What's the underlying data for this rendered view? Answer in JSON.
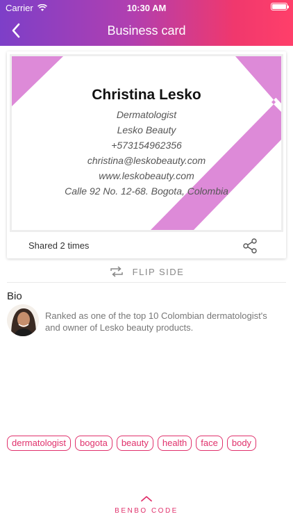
{
  "status_bar": {
    "carrier": "Carrier",
    "time": "10:30 AM",
    "battery_level": 1.0
  },
  "nav": {
    "title": "Business card",
    "back_icon": "chevron-left-icon"
  },
  "card": {
    "name": "Christina Lesko",
    "lines": [
      "Dermatologist",
      "Lesko Beauty",
      "+573154962356",
      "christina@leskobeauty.com",
      "www.leskobeauty.com",
      "Calle 92 No. 12-68. Bogota, Colombia"
    ],
    "accent_color": "#dd8ad8"
  },
  "shared": {
    "text": "Shared 2 times",
    "share_icon": "share-icon"
  },
  "flip": {
    "label": "FLIP SIDE",
    "icon": "flip-arrows-icon"
  },
  "bio": {
    "title": "Bio",
    "text": "Ranked as one of the top 10 Colombian dermatologist's and owner of Lesko beauty products."
  },
  "tags": [
    "dermatologist",
    "bogota",
    "beauty",
    "health",
    "face",
    "body"
  ],
  "footer": {
    "label": "BENBO CODE",
    "icon": "chevron-up-icon"
  },
  "colors": {
    "accent": "#e0306b",
    "header_start": "#7d3fc8",
    "header_end": "#ff3f6a"
  }
}
